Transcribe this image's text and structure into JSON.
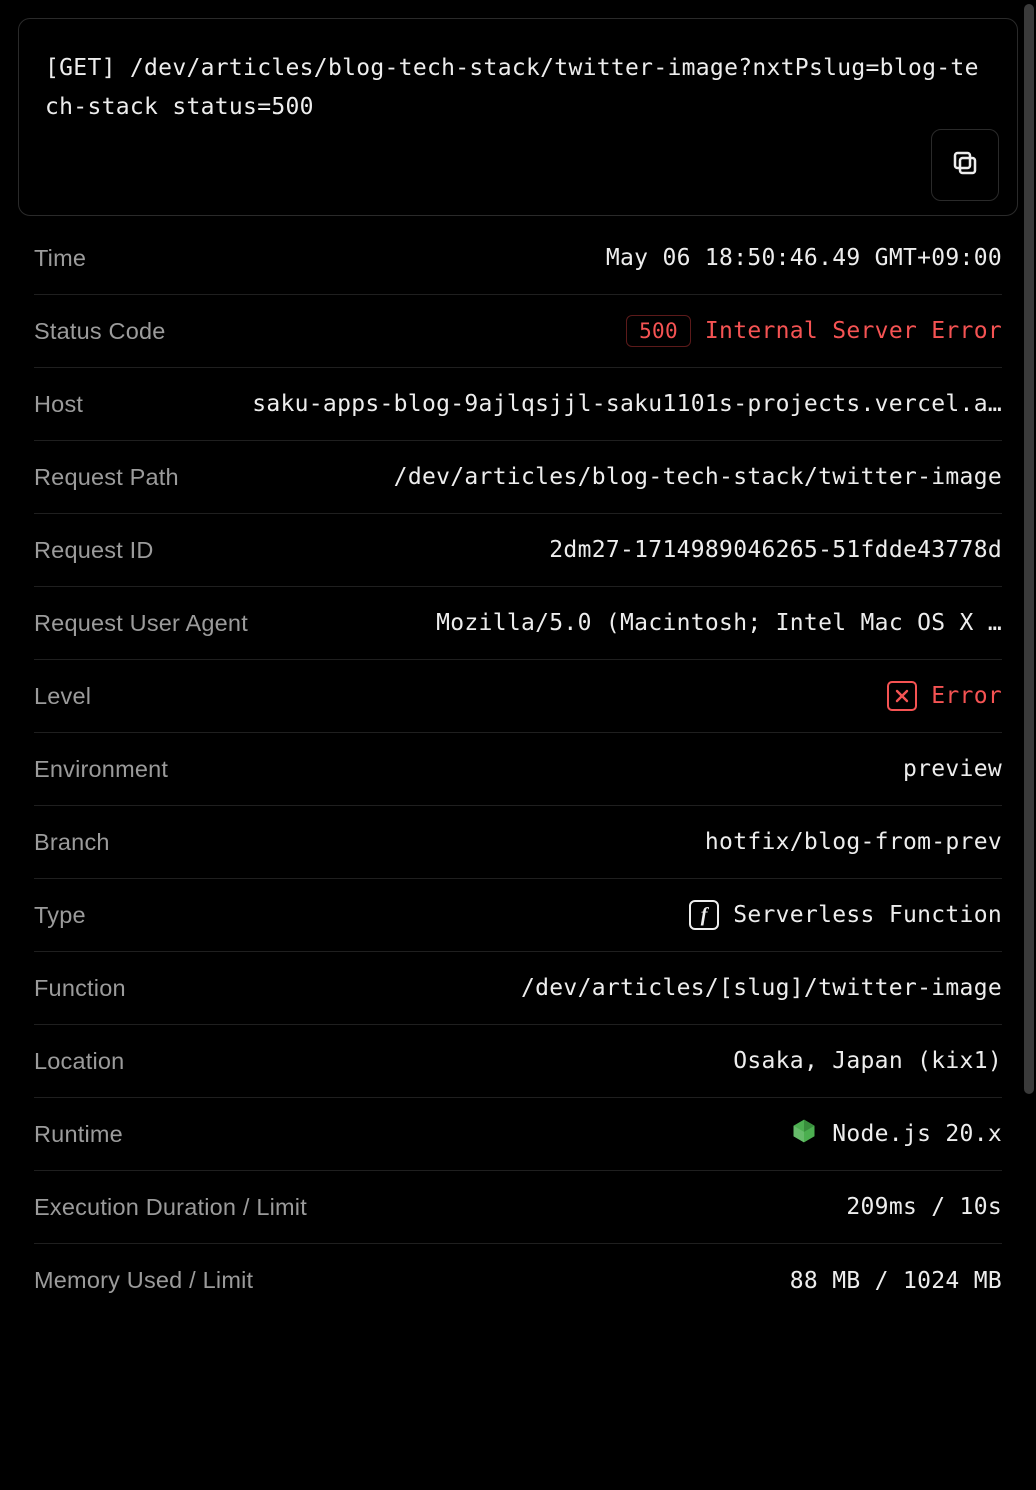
{
  "request_line": "[GET] /dev/articles/blog-tech-stack/twitter-image?nxtPslug=blog-tech-stack status=500",
  "fields": {
    "time": {
      "label": "Time",
      "value": "May 06 18:50:46.49 GMT+09:00"
    },
    "status_code": {
      "label": "Status Code",
      "code": "500",
      "text": "Internal Server Error"
    },
    "host": {
      "label": "Host",
      "value": "saku-apps-blog-9ajlqsjjl-saku1101s-projects.vercel.a…"
    },
    "request_path": {
      "label": "Request Path",
      "value": "/dev/articles/blog-tech-stack/twitter-image"
    },
    "request_id": {
      "label": "Request ID",
      "value": "2dm27-1714989046265-51fdde43778d"
    },
    "user_agent": {
      "label": "Request User Agent",
      "value": "Mozilla/5.0 (Macintosh; Intel Mac OS X …"
    },
    "level": {
      "label": "Level",
      "value": "Error"
    },
    "environment": {
      "label": "Environment",
      "value": "preview"
    },
    "branch": {
      "label": "Branch",
      "value": "hotfix/blog-from-prev"
    },
    "type": {
      "label": "Type",
      "value": "Serverless Function"
    },
    "function": {
      "label": "Function",
      "value": "/dev/articles/[slug]/twitter-image"
    },
    "location": {
      "label": "Location",
      "value": "Osaka, Japan (kix1)"
    },
    "runtime": {
      "label": "Runtime",
      "value": "Node.js 20.x"
    },
    "exec_duration": {
      "label": "Execution Duration / Limit",
      "value": "209ms / 10s"
    },
    "memory": {
      "label": "Memory Used / Limit",
      "value": "88 MB / 1024 MB"
    }
  }
}
